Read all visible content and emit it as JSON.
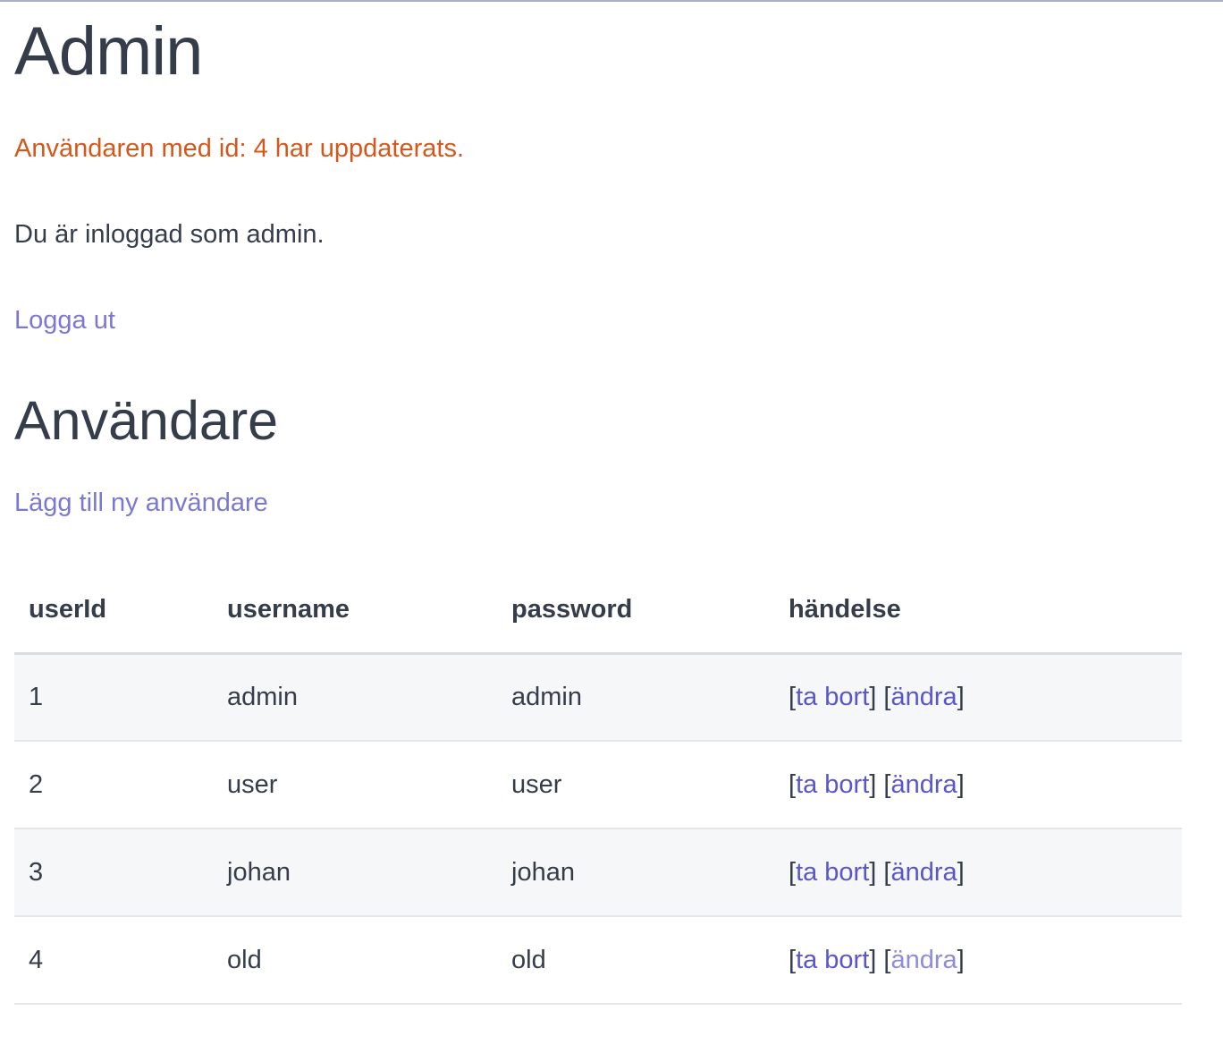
{
  "page": {
    "title": "Admin",
    "flash_message": "Användaren med id: 4 har uppdaterats.",
    "logged_in_text": "Du är inloggad som admin.",
    "logout_label": "Logga ut"
  },
  "users_section": {
    "heading": "Användare",
    "add_user_label": "Lägg till ny användare",
    "table": {
      "columns": [
        "userId",
        "username",
        "password",
        "händelse"
      ],
      "rows": [
        {
          "userId": "1",
          "username": "admin",
          "password": "admin",
          "delete_label": "ta bort",
          "edit_label": "ändra"
        },
        {
          "userId": "2",
          "username": "user",
          "password": "user",
          "delete_label": "ta bort",
          "edit_label": "ändra"
        },
        {
          "userId": "3",
          "username": "johan",
          "password": "johan",
          "delete_label": "ta bort",
          "edit_label": "ändra"
        },
        {
          "userId": "4",
          "username": "old",
          "password": "old",
          "delete_label": "ta bort",
          "edit_label": "ändra"
        }
      ]
    }
  },
  "colors": {
    "text": "#363d4a",
    "flash": "#d4581c",
    "link": "#7b78d3",
    "action_link": "#5a56c9",
    "row_stripe": "#f6f7f9"
  }
}
